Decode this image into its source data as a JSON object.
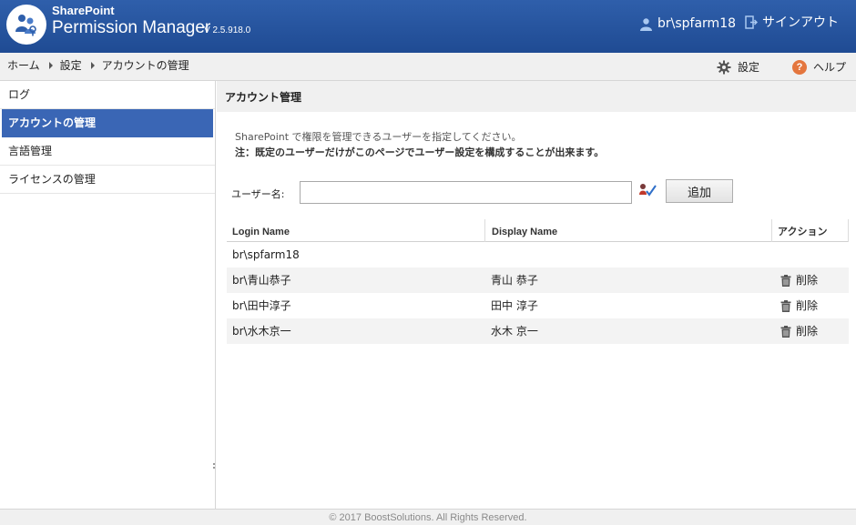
{
  "header": {
    "brand_top": "SharePoint",
    "brand_main": "Permission Manager",
    "version": "V 2.5.918.0",
    "user_name": "br\\spfarm18",
    "signout_label": "サインアウト"
  },
  "breadcrumb": [
    "ホーム",
    "設定",
    "アカウントの管理"
  ],
  "toolbar": {
    "settings_label": "設定",
    "help_label": "ヘルプ"
  },
  "sidebar": {
    "items": [
      {
        "label": "ログ",
        "active": false
      },
      {
        "label": "アカウントの管理",
        "active": true
      },
      {
        "label": "言語管理",
        "active": false
      },
      {
        "label": "ライセンスの管理",
        "active": false
      }
    ]
  },
  "main": {
    "title": "アカウント管理",
    "description": "SharePoint で権限を管理できるユーザーを指定してください。",
    "note": "注：既定のユーザーだけがこのページでユーザー設定を構成することが出来ます。",
    "user_label": "ユーザー名:",
    "user_input_value": "",
    "add_button_label": "追加"
  },
  "table": {
    "columns": [
      "Login Name",
      "Display Name",
      "アクション"
    ],
    "rows": [
      {
        "login": "br\\spfarm18",
        "display": "",
        "action": ""
      },
      {
        "login": "br\\青山恭子",
        "display": "青山 恭子",
        "action": "削除"
      },
      {
        "login": "br\\田中淳子",
        "display": "田中 淳子",
        "action": "削除"
      },
      {
        "login": "br\\水木京一",
        "display": "水木 京一",
        "action": "削除"
      }
    ]
  },
  "footer": {
    "copyright": "© 2017 BoostSolutions. All Rights Reserved."
  },
  "colors": {
    "header_blue": "#2f5fab",
    "active_nav": "#3a66b5",
    "help_orange": "#e4763e"
  }
}
